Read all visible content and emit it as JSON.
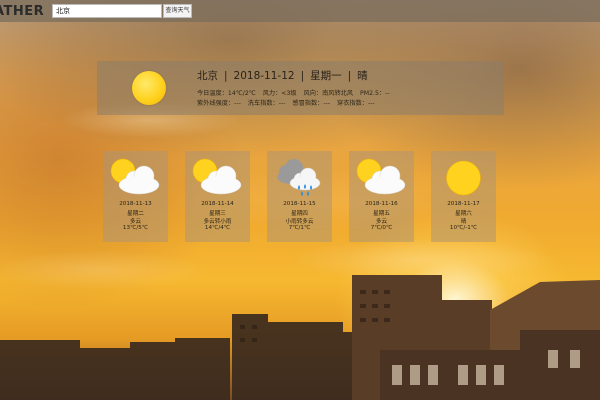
{
  "brand": "ATHER",
  "search": {
    "value": "北京",
    "button_label": "查询天气"
  },
  "today": {
    "city": "北京",
    "date": "2018-11-12",
    "weekday": "星期一",
    "condition": "晴",
    "icon": "sun-icon",
    "details_line1": [
      "今日温度：14℃/2℃",
      "风力：<3级",
      "风向：南风转北风",
      "PM2.5：--"
    ],
    "details_line2": [
      "紫外线强度：---",
      "洗车指数：---",
      "感冒指数：---",
      "穿衣指数：---"
    ]
  },
  "forecast": [
    {
      "date": "2018-11-13",
      "weekday": "星期二",
      "condition": "多云",
      "temp": "13℃/5℃",
      "icon": "partly-cloudy-icon"
    },
    {
      "date": "2018-11-14",
      "weekday": "星期三",
      "condition": "多云转小雨",
      "temp": "14℃/4℃",
      "icon": "partly-cloudy-icon"
    },
    {
      "date": "2018-11-15",
      "weekday": "星期四",
      "condition": "小雨转多云",
      "temp": "7℃/1℃",
      "icon": "rain-icon"
    },
    {
      "date": "2018-11-16",
      "weekday": "星期五",
      "condition": "多云",
      "temp": "7℃/0℃",
      "icon": "partly-cloudy-icon"
    },
    {
      "date": "2018-11-17",
      "weekday": "星期六",
      "condition": "晴",
      "temp": "10℃/-1℃",
      "icon": "sun-icon"
    }
  ],
  "colors": {
    "sun": "#ffd21f",
    "panel": "#8c7d69",
    "sky": "#f0aa30"
  }
}
